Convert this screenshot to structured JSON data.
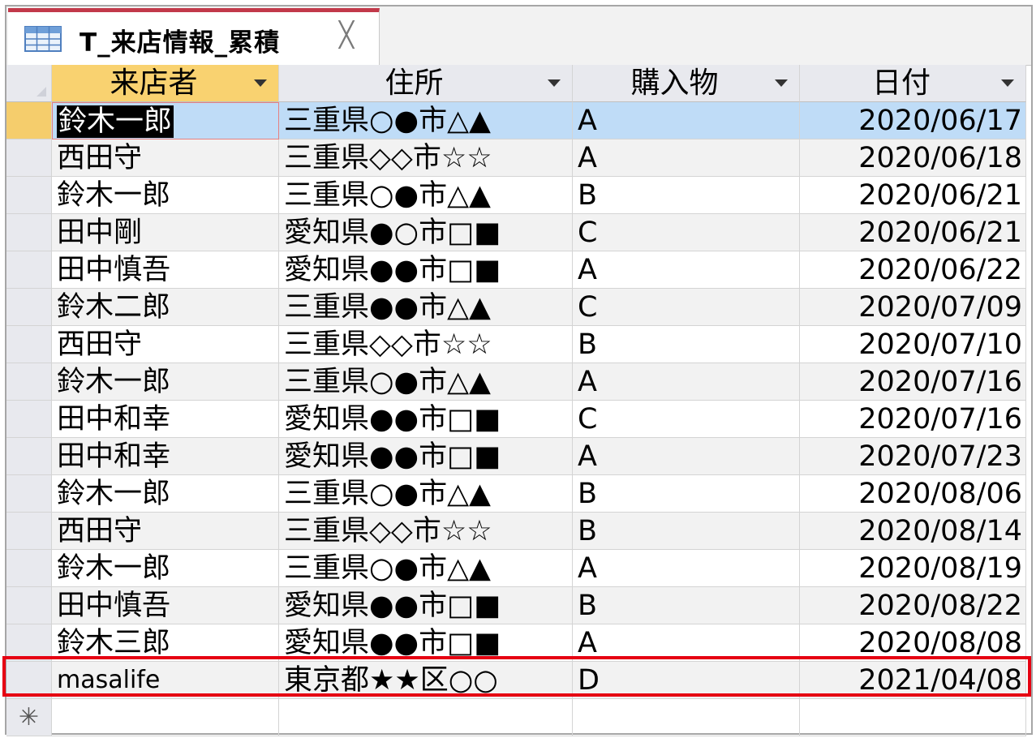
{
  "tab": {
    "title": "T_来店情報_累積",
    "close_glyph": "╳",
    "icon": "table-icon",
    "accent_color": "#c2394a"
  },
  "columns": [
    "来店者",
    "住所",
    "購入物",
    "日付"
  ],
  "rows": [
    [
      "鈴木一郎",
      "三重県○●市△▲",
      "A",
      "2020/06/17"
    ],
    [
      "西田守",
      "三重県◇◇市☆☆",
      "A",
      "2020/06/18"
    ],
    [
      "鈴木一郎",
      "三重県○●市△▲",
      "B",
      "2020/06/21"
    ],
    [
      "田中剛",
      "愛知県●○市□■",
      "C",
      "2020/06/21"
    ],
    [
      "田中慎吾",
      "愛知県●●市□■",
      "A",
      "2020/06/22"
    ],
    [
      "鈴木二郎",
      "三重県●●市△▲",
      "C",
      "2020/07/09"
    ],
    [
      "西田守",
      "三重県◇◇市☆☆",
      "B",
      "2020/07/10"
    ],
    [
      "鈴木一郎",
      "三重県○●市△▲",
      "A",
      "2020/07/16"
    ],
    [
      "田中和幸",
      "愛知県●●市□■",
      "C",
      "2020/07/16"
    ],
    [
      "田中和幸",
      "愛知県●●市□■",
      "A",
      "2020/07/23"
    ],
    [
      "鈴木一郎",
      "三重県○●市△▲",
      "B",
      "2020/08/06"
    ],
    [
      "西田守",
      "三重県◇◇市☆☆",
      "B",
      "2020/08/14"
    ],
    [
      "鈴木一郎",
      "三重県○●市△▲",
      "A",
      "2020/08/19"
    ],
    [
      "田中慎吾",
      "愛知県●●市□■",
      "B",
      "2020/08/22"
    ],
    [
      "鈴木三郎",
      "愛知県●●市□■",
      "A",
      "2020/08/08"
    ],
    [
      "masalife",
      "東京都★★区○○",
      "D",
      "2021/04/08"
    ]
  ],
  "new_row_marker": "✳",
  "colors": {
    "header_active": "#f9d270",
    "current_row": "#bfdcf7",
    "highlight_border": "#e60012"
  }
}
